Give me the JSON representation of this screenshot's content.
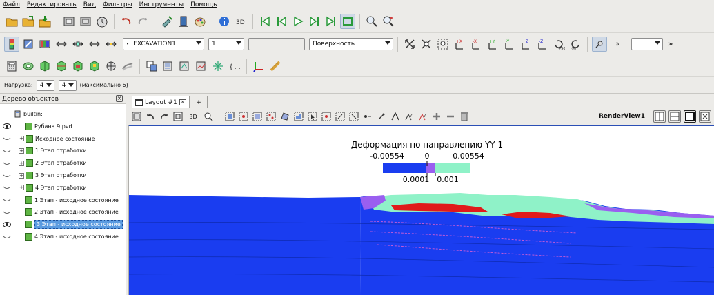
{
  "menu": [
    "Файл",
    "Редактировать",
    "Вид",
    "Фильтры",
    "Инструменты",
    "Помощь"
  ],
  "toolbar2": {
    "source_select": "EXCAVATION1",
    "component_select": "1",
    "text_field": "",
    "representation_select": "Поверхность",
    "more_label": "»",
    "more_label2": "»"
  },
  "load": {
    "label": "Нагрузка:",
    "value1": "4",
    "value2": "4",
    "max_label": "(максимально 6)"
  },
  "tree": {
    "title": "Дерево объектов",
    "items": [
      {
        "label": "builtin:",
        "visible": false,
        "expander": false,
        "selected": false
      },
      {
        "label": "Рубана 9.pvd",
        "visible": true,
        "expander": false,
        "selected": false
      },
      {
        "label": "Исходное состояние",
        "visible": false,
        "expander": true,
        "selected": false
      },
      {
        "label": "1 Этап отработки",
        "visible": false,
        "expander": true,
        "selected": false
      },
      {
        "label": "2 Этап отработки",
        "visible": false,
        "expander": true,
        "selected": false
      },
      {
        "label": "3 Этап отработки",
        "visible": false,
        "expander": true,
        "selected": false
      },
      {
        "label": "4 Этап отработки",
        "visible": false,
        "expander": true,
        "selected": false
      },
      {
        "label": "1 Этап - исходное состояние",
        "visible": false,
        "expander": false,
        "selected": false
      },
      {
        "label": "2 Этап - исходное состояние",
        "visible": false,
        "expander": false,
        "selected": false
      },
      {
        "label": "3 Этап - исходное состояние",
        "visible": true,
        "expander": false,
        "selected": true
      },
      {
        "label": "4 Этап - исходное состояние",
        "visible": false,
        "expander": false,
        "selected": false
      }
    ]
  },
  "tabs": {
    "active": "Layout #1",
    "add": "+"
  },
  "view": {
    "name": "RenderView1",
    "label_3d": "3D"
  },
  "legend": {
    "title": "Деформация по направлению YY 1",
    "top_ticks": [
      "-0.00554",
      "0",
      "0.00554"
    ],
    "bottom_ticks": [
      "0.0001",
      "0.001"
    ],
    "colors": {
      "low": "#1a3df0",
      "mid": "#9a5ff0",
      "high": "#8ff2c8",
      "red": "#e01a1a"
    }
  }
}
